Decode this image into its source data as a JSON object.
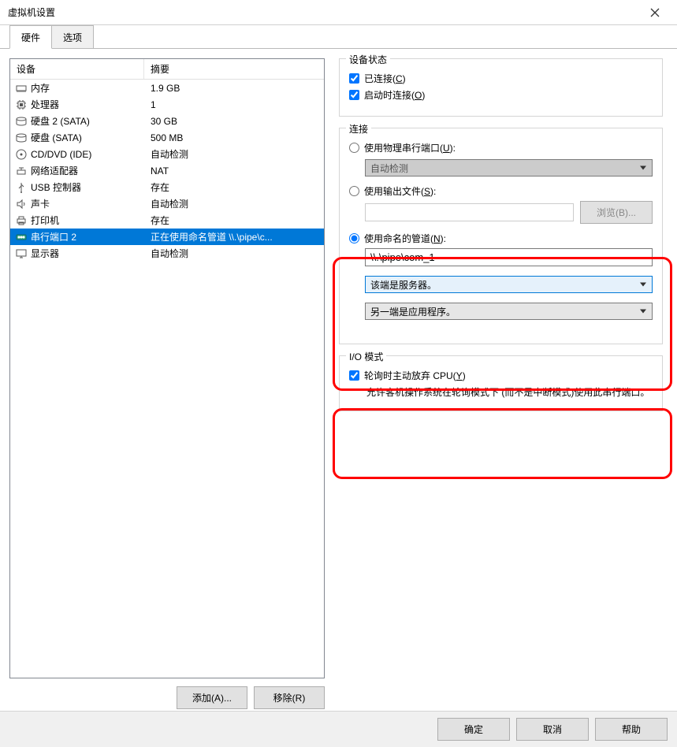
{
  "window": {
    "title": "虚拟机设置"
  },
  "tabs": {
    "hardware": "硬件",
    "options": "选项"
  },
  "list": {
    "header_device": "设备",
    "header_summary": "摘要",
    "rows": [
      {
        "icon": "memory",
        "name": "内存",
        "summary": "1.9 GB"
      },
      {
        "icon": "cpu",
        "name": "处理器",
        "summary": "1"
      },
      {
        "icon": "disk",
        "name": "硬盘 2 (SATA)",
        "summary": "30 GB"
      },
      {
        "icon": "disk",
        "name": "硬盘 (SATA)",
        "summary": "500 MB"
      },
      {
        "icon": "cd",
        "name": "CD/DVD (IDE)",
        "summary": "自动检测"
      },
      {
        "icon": "net",
        "name": "网络适配器",
        "summary": "NAT"
      },
      {
        "icon": "usb",
        "name": "USB 控制器",
        "summary": "存在"
      },
      {
        "icon": "sound",
        "name": "声卡",
        "summary": "自动检测"
      },
      {
        "icon": "printer",
        "name": "打印机",
        "summary": "存在"
      },
      {
        "icon": "serial",
        "name": "串行端口 2",
        "summary": "正在使用命名管道 \\\\.\\pipe\\c...",
        "selected": true
      },
      {
        "icon": "display",
        "name": "显示器",
        "summary": "自动检测"
      }
    ]
  },
  "buttons": {
    "add": "添加(A)...",
    "remove": "移除(R)",
    "browse": "浏览(B)...",
    "ok": "确定",
    "cancel": "取消",
    "help": "帮助"
  },
  "status_group": {
    "legend": "设备状态",
    "connected_pre": "已连接(",
    "connected_key": "C",
    "connected_post": ")",
    "connect_at_poweron_pre": "启动时连接(",
    "connect_at_poweron_key": "O",
    "connect_at_poweron_post": ")"
  },
  "connect_group": {
    "legend": "连接",
    "physical_pre": "使用物理串行端口(",
    "physical_key": "U",
    "physical_post": "):",
    "physical_value": "自动检测",
    "output_file_pre": "使用输出文件(",
    "output_file_key": "S",
    "output_file_post": "):",
    "named_pipe_pre": "使用命名的管道(",
    "named_pipe_key": "N",
    "named_pipe_post": "):",
    "pipe_value": "\\\\.\\pipe\\com_1",
    "end1": "该端是服务器。",
    "end2": "另一端是应用程序。"
  },
  "io_group": {
    "legend": "I/O 模式",
    "yield_pre": "轮询时主动放弃 CPU(",
    "yield_key": "Y",
    "yield_post": ")",
    "hint": "允许客机操作系统在轮询模式下 (而不是中断模式)使用此串行端口。"
  }
}
